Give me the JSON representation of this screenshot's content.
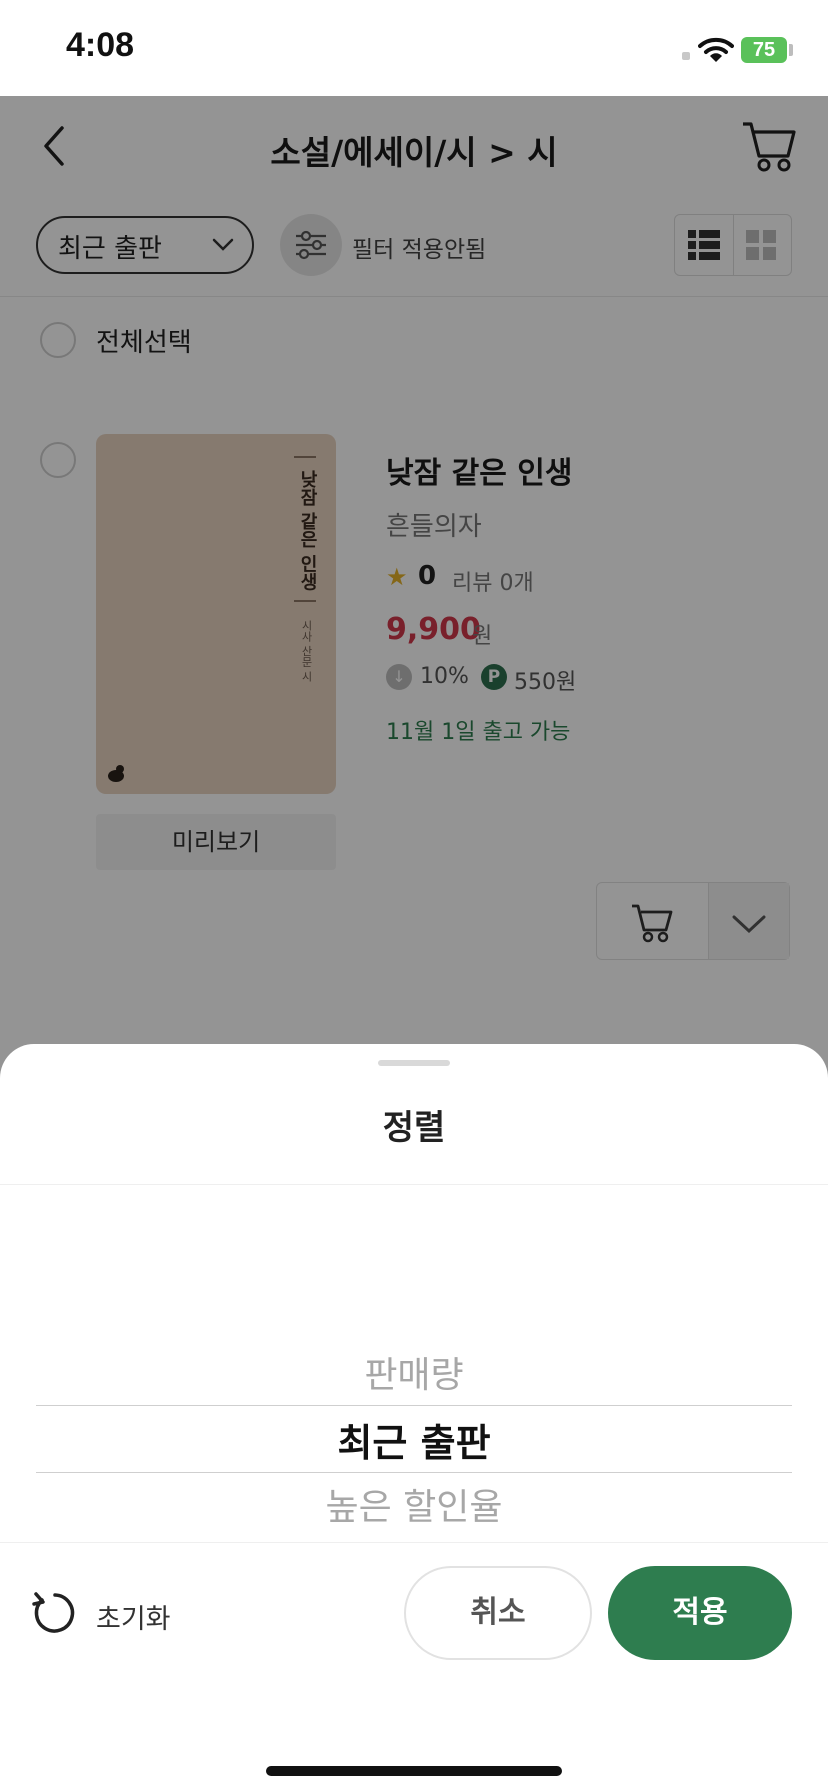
{
  "status_bar": {
    "time": "4:08",
    "battery": "75"
  },
  "header": {
    "title": "소설/에세이/시 > 시"
  },
  "toolbar": {
    "sort_value": "최근 출판",
    "filter_label": "필터 적용안됨"
  },
  "list": {
    "select_all_label": "전체선택"
  },
  "book": {
    "cover_title": "낮잠 같은 인생",
    "cover_subtitle": "시사 산문 시",
    "preview_label": "미리보기",
    "title": "낮잠 같은 인생",
    "author": "흔들의자",
    "rating": "0",
    "reviews": "리뷰 0개",
    "price": "9,900",
    "price_unit": "원",
    "discount": "10%",
    "points": "550원",
    "point_badge": "P",
    "shipping": "11월 1일 출고 가능"
  },
  "sheet": {
    "title": "정렬",
    "options": [
      "판매량",
      "최근 출판",
      "높은 할인율"
    ],
    "selected_index": 1,
    "reset_label": "초기화",
    "cancel_label": "취소",
    "apply_label": "적용"
  },
  "colors": {
    "accent": "#2e7d4f",
    "price": "#d0374a",
    "point": "#2e6f4e"
  }
}
